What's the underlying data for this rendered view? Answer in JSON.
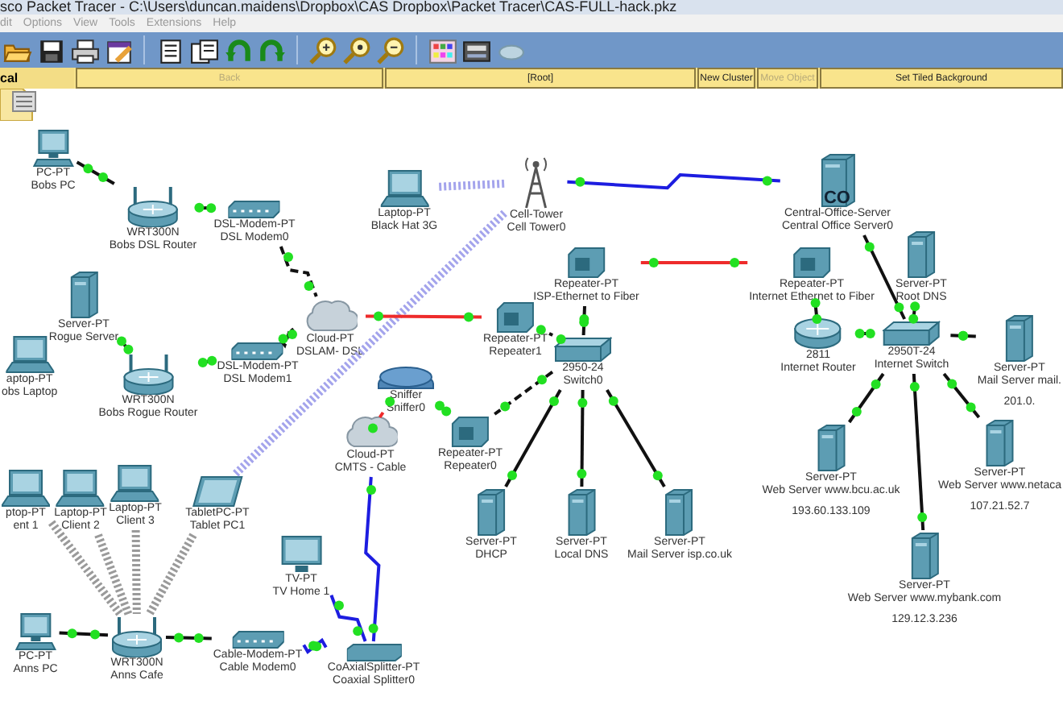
{
  "window": {
    "title": "sco Packet Tracer - C:\\Users\\duncan.maidens\\Dropbox\\CAS Dropbox\\Packet Tracer\\CAS-FULL-hack.pkz"
  },
  "menu": [
    "dit",
    "Options",
    "View",
    "Tools",
    "Extensions",
    "Help"
  ],
  "workspace_bar": {
    "tab": "cal",
    "buttons": [
      {
        "label": "Back",
        "disabled": true
      },
      {
        "label": "[Root]",
        "disabled": false
      },
      {
        "label": "New Cluster",
        "disabled": false
      },
      {
        "label": "Move Object",
        "disabled": true
      },
      {
        "label": "Set Tiled Background",
        "disabled": false
      }
    ]
  },
  "nodes": [
    {
      "kind": "pc",
      "type": "PC-PT",
      "name": "Bobs PC"
    },
    {
      "kind": "wrt",
      "type": "WRT300N",
      "name": "Bobs DSL Router"
    },
    {
      "kind": "modem",
      "type": "DSL-Modem-PT",
      "name": "DSL Modem0"
    },
    {
      "kind": "laptop",
      "type": "Laptop-PT",
      "name": "Black Hat 3G"
    },
    {
      "kind": "tower",
      "type": "Cell-Tower",
      "name": "Cell Tower0"
    },
    {
      "kind": "co",
      "type": "Central-Office-Server",
      "name": "Central Office Server0",
      "badge": "CO"
    },
    {
      "kind": "repeater",
      "type": "Repeater-PT",
      "name": "ISP-Ethernet to Fiber"
    },
    {
      "kind": "repeater",
      "type": "Repeater-PT",
      "name": "Internet Ethernet to Fiber"
    },
    {
      "kind": "server",
      "type": "Server-PT",
      "name": "Root DNS"
    },
    {
      "kind": "server",
      "type": "Server-PT",
      "name": "Rogue Server"
    },
    {
      "kind": "laptop",
      "type": "aptop-PT",
      "name": "obs Laptop"
    },
    {
      "kind": "wrt",
      "type": "WRT300N",
      "name": "Bobs Rogue Router"
    },
    {
      "kind": "modem",
      "type": "DSL-Modem-PT",
      "name": "DSL Modem1"
    },
    {
      "kind": "cloud",
      "type": "Cloud-PT",
      "name": "DSLAM- DSL"
    },
    {
      "kind": "repeater",
      "type": "Repeater-PT",
      "name": "Repeater1"
    },
    {
      "kind": "switch",
      "type": "2950-24",
      "name": "Switch0"
    },
    {
      "kind": "router",
      "type": "2811",
      "name": "Internet Router"
    },
    {
      "kind": "switch",
      "type": "2950T-24",
      "name": "Internet Switch"
    },
    {
      "kind": "server",
      "type": "Server-PT",
      "name": "Mail Server mail.",
      "ip": "201.0."
    },
    {
      "kind": "sniffer",
      "type": "Sniffer",
      "name": "Sniffer0"
    },
    {
      "kind": "cloud",
      "type": "Cloud-PT",
      "name": "CMTS - Cable"
    },
    {
      "kind": "repeater",
      "type": "Repeater-PT",
      "name": "Repeater0"
    },
    {
      "kind": "server",
      "type": "Server-PT",
      "name": "Web Server www.bcu.ac.uk",
      "ip": "193.60.133.109"
    },
    {
      "kind": "server",
      "type": "Server-PT",
      "name": "Web Server  www.netaca",
      "ip": "107.21.52.7"
    },
    {
      "kind": "laptop",
      "type": "ptop-PT",
      "name": "ent 1"
    },
    {
      "kind": "laptop",
      "type": "Laptop-PT",
      "name": "Client 2"
    },
    {
      "kind": "laptop",
      "type": "Laptop-PT",
      "name": "Client 3"
    },
    {
      "kind": "tablet",
      "type": "TabletPC-PT",
      "name": "Tablet PC1"
    },
    {
      "kind": "server",
      "type": "Server-PT",
      "name": "DHCP"
    },
    {
      "kind": "server",
      "type": "Server-PT",
      "name": "Local DNS"
    },
    {
      "kind": "server",
      "type": "Server-PT",
      "name": "Mail Server isp.co.uk"
    },
    {
      "kind": "tv",
      "type": "TV-PT",
      "name": "TV Home 1"
    },
    {
      "kind": "server",
      "type": "Server-PT",
      "name": "Web Server   www.mybank.com",
      "ip": "129.12.3.236"
    },
    {
      "kind": "pc",
      "type": "PC-PT",
      "name": "Anns PC"
    },
    {
      "kind": "wrt",
      "type": "WRT300N",
      "name": "Anns Cafe"
    },
    {
      "kind": "modem",
      "type": "Cable-Modem-PT",
      "name": "Cable Modem0"
    },
    {
      "kind": "splitter",
      "type": "CoAxialSplitter-PT",
      "name": "Coaxial Splitter0"
    }
  ],
  "links": [
    {
      "kind": "copper"
    },
    {
      "kind": "copper"
    },
    {
      "kind": "phone"
    },
    {
      "kind": "copper"
    },
    {
      "kind": "copper"
    },
    {
      "kind": "phone"
    },
    {
      "kind": "cellular"
    },
    {
      "kind": "coax"
    },
    {
      "kind": "cellular"
    },
    {
      "kind": "fiber"
    },
    {
      "kind": "copper"
    },
    {
      "kind": "copper"
    },
    {
      "kind": "fiber"
    },
    {
      "kind": "copper"
    },
    {
      "kind": "copper"
    },
    {
      "kind": "copper"
    },
    {
      "kind": "copper"
    },
    {
      "kind": "copper"
    },
    {
      "kind": "copper"
    },
    {
      "kind": "copper"
    },
    {
      "kind": "copper"
    },
    {
      "kind": "crossover"
    },
    {
      "kind": "copper"
    },
    {
      "kind": "copper"
    },
    {
      "kind": "copper"
    },
    {
      "kind": "fiber"
    },
    {
      "kind": "fiber"
    },
    {
      "kind": "coax"
    },
    {
      "kind": "coax"
    },
    {
      "kind": "coax"
    },
    {
      "kind": "copper"
    },
    {
      "kind": "copper"
    },
    {
      "kind": "wifi"
    },
    {
      "kind": "wifi"
    },
    {
      "kind": "wifi"
    },
    {
      "kind": "wifi"
    }
  ]
}
